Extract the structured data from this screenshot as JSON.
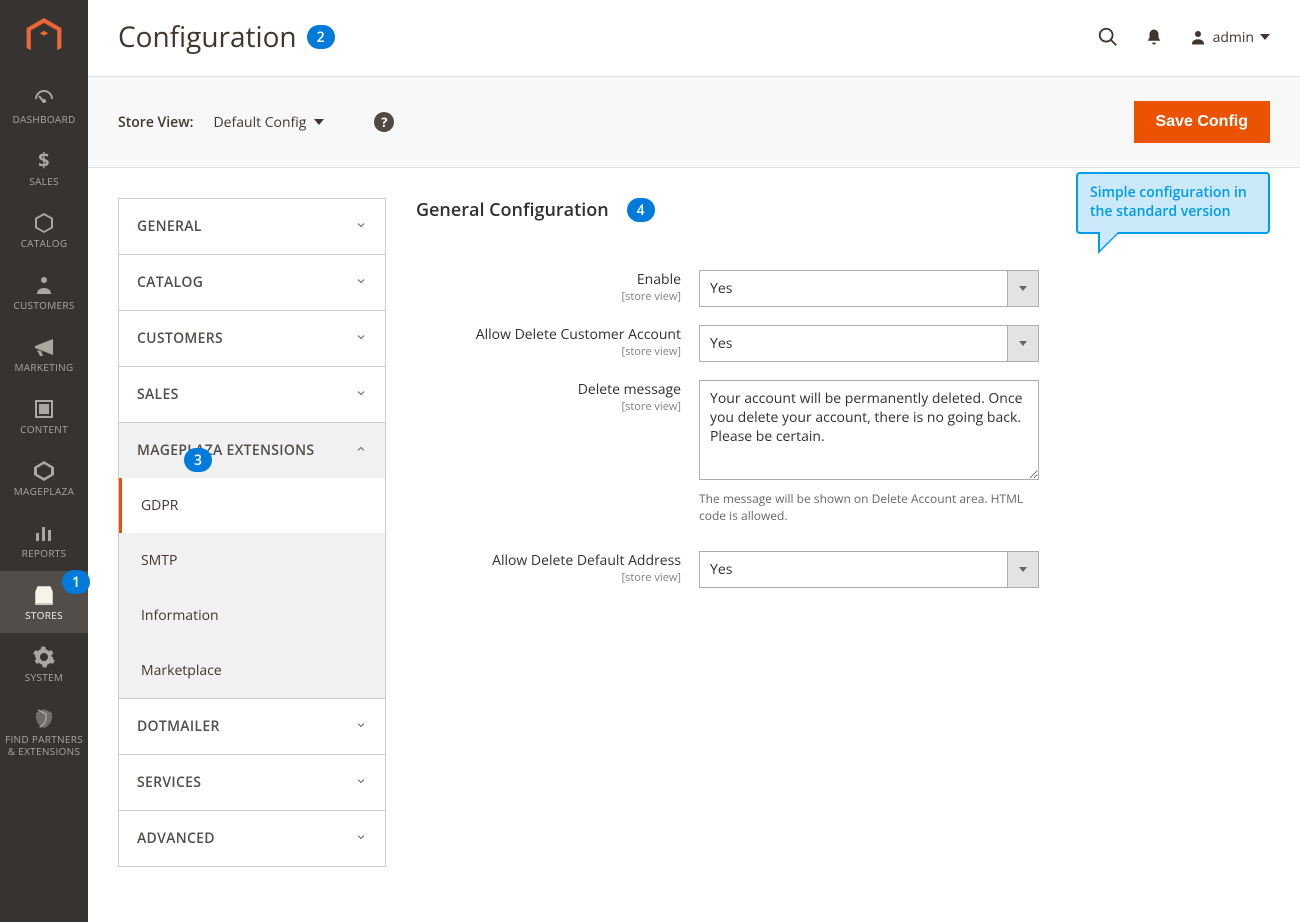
{
  "sidebar": {
    "items": [
      {
        "label": "Dashboard",
        "name": "sidebar-item-dashboard"
      },
      {
        "label": "Sales",
        "name": "sidebar-item-sales"
      },
      {
        "label": "Catalog",
        "name": "sidebar-item-catalog"
      },
      {
        "label": "Customers",
        "name": "sidebar-item-customers"
      },
      {
        "label": "Marketing",
        "name": "sidebar-item-marketing"
      },
      {
        "label": "Content",
        "name": "sidebar-item-content"
      },
      {
        "label": "Mageplaza",
        "name": "sidebar-item-mageplaza"
      },
      {
        "label": "Reports",
        "name": "sidebar-item-reports"
      },
      {
        "label": "Stores",
        "name": "sidebar-item-stores",
        "active": true
      },
      {
        "label": "System",
        "name": "sidebar-item-system"
      },
      {
        "label": "Find Partners & Extensions",
        "name": "sidebar-item-partners"
      }
    ]
  },
  "header": {
    "title": "Configuration",
    "admin_label": "admin"
  },
  "toolbar": {
    "store_view_label": "Store View:",
    "store_view_value": "Default Config",
    "save_label": "Save Config"
  },
  "tabs": [
    {
      "label": "General",
      "expanded": false
    },
    {
      "label": "Catalog",
      "expanded": false
    },
    {
      "label": "Customers",
      "expanded": false
    },
    {
      "label": "Sales",
      "expanded": false
    },
    {
      "label": "Mageplaza Extensions",
      "expanded": true,
      "items": [
        {
          "label": "GDPR",
          "active": true
        },
        {
          "label": "SMTP"
        },
        {
          "label": "Information"
        },
        {
          "label": "Marketplace"
        }
      ]
    },
    {
      "label": "Dotmailer",
      "expanded": false
    },
    {
      "label": "Services",
      "expanded": false
    },
    {
      "label": "Advanced",
      "expanded": false
    }
  ],
  "section": {
    "title": "General Configuration",
    "fields": {
      "enable": {
        "label": "Enable",
        "scope": "[store view]",
        "value": "Yes"
      },
      "allow_delete_customer": {
        "label": "Allow Delete Customer Account",
        "scope": "[store view]",
        "value": "Yes"
      },
      "delete_message": {
        "label": "Delete message",
        "scope": "[store view]",
        "value": "Your account will be permanently deleted. Once you delete your account, there is no going back. Please be certain.",
        "note": "The message will be shown on Delete Account area. HTML code is allowed."
      },
      "allow_delete_address": {
        "label": "Allow Delete Default Address",
        "scope": "[store view]",
        "value": "Yes"
      }
    }
  },
  "badges": {
    "b1": "1",
    "b2": "2",
    "b3": "3",
    "b4": "4"
  },
  "callout": {
    "text": "Simple configuration in the standard version"
  }
}
